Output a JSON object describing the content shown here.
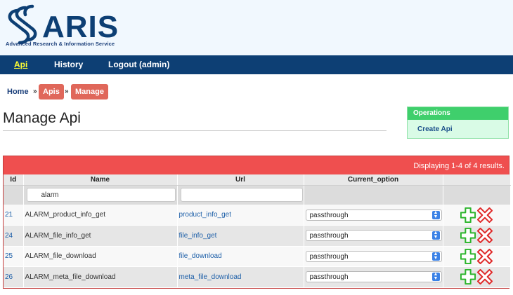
{
  "header": {
    "logo_word": "ARIS",
    "logo_subtitle": "Advanced Research & Information Service",
    "colors": {
      "brand_navy": "#0d3f74",
      "accent_yellow": "#ffff33"
    }
  },
  "nav": {
    "items": [
      {
        "label": "Api",
        "active": true
      },
      {
        "label": "History",
        "active": false
      },
      {
        "label": "Logout (admin)",
        "active": false
      }
    ]
  },
  "breadcrumb": {
    "home": "Home",
    "separator": "»",
    "items": [
      "Apis",
      "Manage"
    ]
  },
  "page": {
    "title": "Manage Api"
  },
  "operations": {
    "title": "Operations",
    "links": [
      "Create Api"
    ]
  },
  "grid": {
    "summary": "Displaying 1-4 of 4 results.",
    "columns": [
      "Id",
      "Name",
      "Url",
      "Current_option"
    ],
    "filters": {
      "name": "alarm",
      "url": ""
    },
    "rows": [
      {
        "id": "21",
        "name": "ALARM_product_info_get",
        "url": "product_info_get",
        "option": "passthrough"
      },
      {
        "id": "24",
        "name": "ALARM_file_info_get",
        "url": "file_info_get",
        "option": "passthrough"
      },
      {
        "id": "25",
        "name": "ALARM_file_download",
        "url": "file_download",
        "option": "passthrough"
      },
      {
        "id": "26",
        "name": "ALARM_meta_file_download",
        "url": "meta_file_download",
        "option": "passthrough"
      }
    ],
    "row_actions": [
      "plus-icon",
      "delete-x-icon"
    ]
  }
}
